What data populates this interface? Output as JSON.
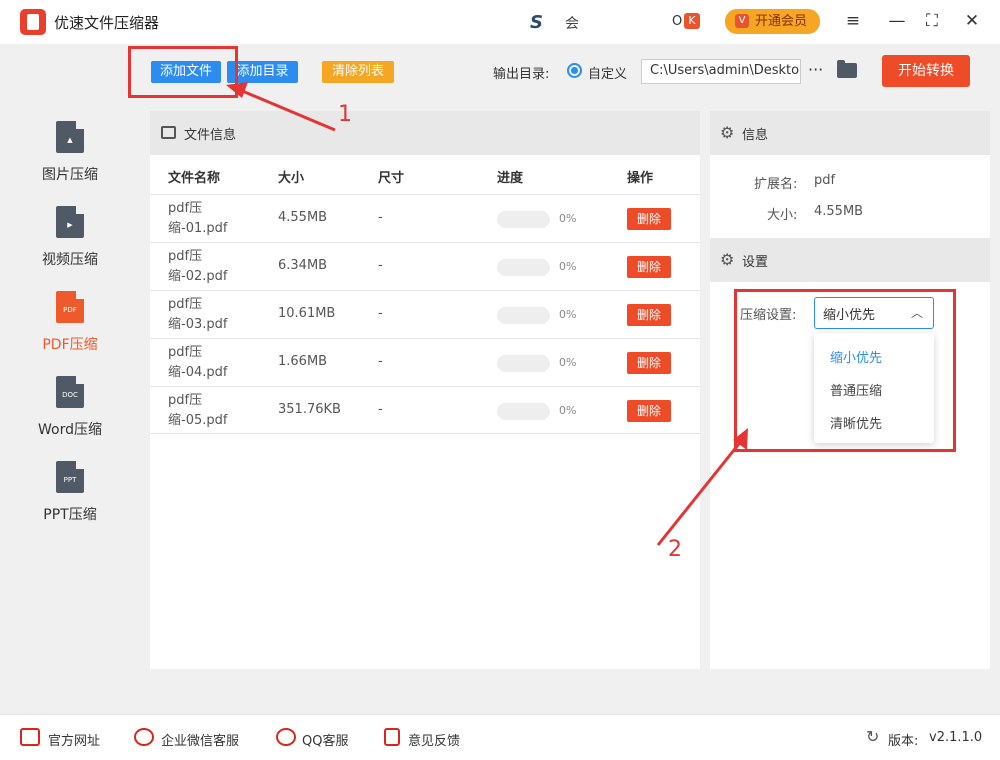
{
  "app": {
    "title": "优速文件压缩器",
    "center_logo": "S",
    "center_text": "会",
    "badge_o": "O",
    "badge_k": "K",
    "vip_label": "开通会员",
    "vip_icon": "V",
    "menu_icon": "≡",
    "min_icon": "—",
    "max_icon": "⛶",
    "close_icon": "✕"
  },
  "sidebar": {
    "items": [
      {
        "label": "图片压缩",
        "icon": "image-file-icon",
        "icon_text": "▲"
      },
      {
        "label": "视频压缩",
        "icon": "video-file-icon",
        "icon_text": "▶"
      },
      {
        "label": "PDF压缩",
        "icon": "pdf-file-icon",
        "icon_text": "PDF",
        "active": true
      },
      {
        "label": "Word压缩",
        "icon": "doc-file-icon",
        "icon_text": "DOC"
      },
      {
        "label": "PPT压缩",
        "icon": "ppt-file-icon",
        "icon_text": "PPT"
      }
    ]
  },
  "toolbar": {
    "add_file": "添加文件",
    "add_dir": "添加目录",
    "clear_list": "清除列表",
    "output_label": "输出目录:",
    "custom_label": "自定义",
    "output_path": "C:\\Users\\admin\\Deskto",
    "more": "···",
    "start": "开始转换"
  },
  "file_panel": {
    "title": "文件信息",
    "headers": {
      "name": "文件名称",
      "size": "大小",
      "dim": "尺寸",
      "progress": "进度",
      "action": "操作"
    },
    "rows": [
      {
        "name": "pdf压缩-01.pdf",
        "size": "4.55MB",
        "dim": "-",
        "pct": "0%",
        "progress": 0,
        "action": "删除"
      },
      {
        "name": "pdf压缩-02.pdf",
        "size": "6.34MB",
        "dim": "-",
        "pct": "0%",
        "progress": 0,
        "action": "删除"
      },
      {
        "name": "pdf压缩-03.pdf",
        "size": "10.61MB",
        "dim": "-",
        "pct": "0%",
        "progress": 0,
        "action": "删除"
      },
      {
        "name": "pdf压缩-04.pdf",
        "size": "1.66MB",
        "dim": "-",
        "pct": "0%",
        "progress": 0,
        "action": "删除"
      },
      {
        "name": "pdf压缩-05.pdf",
        "size": "351.76KB",
        "dim": "-",
        "pct": "0%",
        "progress": 0,
        "action": "删除"
      }
    ]
  },
  "info_panel": {
    "title": "信息",
    "ext_label": "扩展名:",
    "ext_value": "pdf",
    "size_label": "大小:",
    "size_value": "4.55MB",
    "settings_title": "设置",
    "compress_label": "压缩设置:",
    "selected": "缩小优先",
    "options": [
      "缩小优先",
      "普通压缩",
      "清晰优先"
    ]
  },
  "footer": {
    "website": "官方网址",
    "wechat": "企业微信客服",
    "qq": "QQ客服",
    "feedback": "意见反馈",
    "version_label": "版本:",
    "version": "v2.1.1.0"
  },
  "annotations": {
    "num1": "1",
    "num2": "2"
  },
  "colors": {
    "accent_blue": "#2d8cf0",
    "accent_red": "#ee4b28",
    "accent_orange": "#f5a623",
    "annotation_red": "#e53434"
  }
}
